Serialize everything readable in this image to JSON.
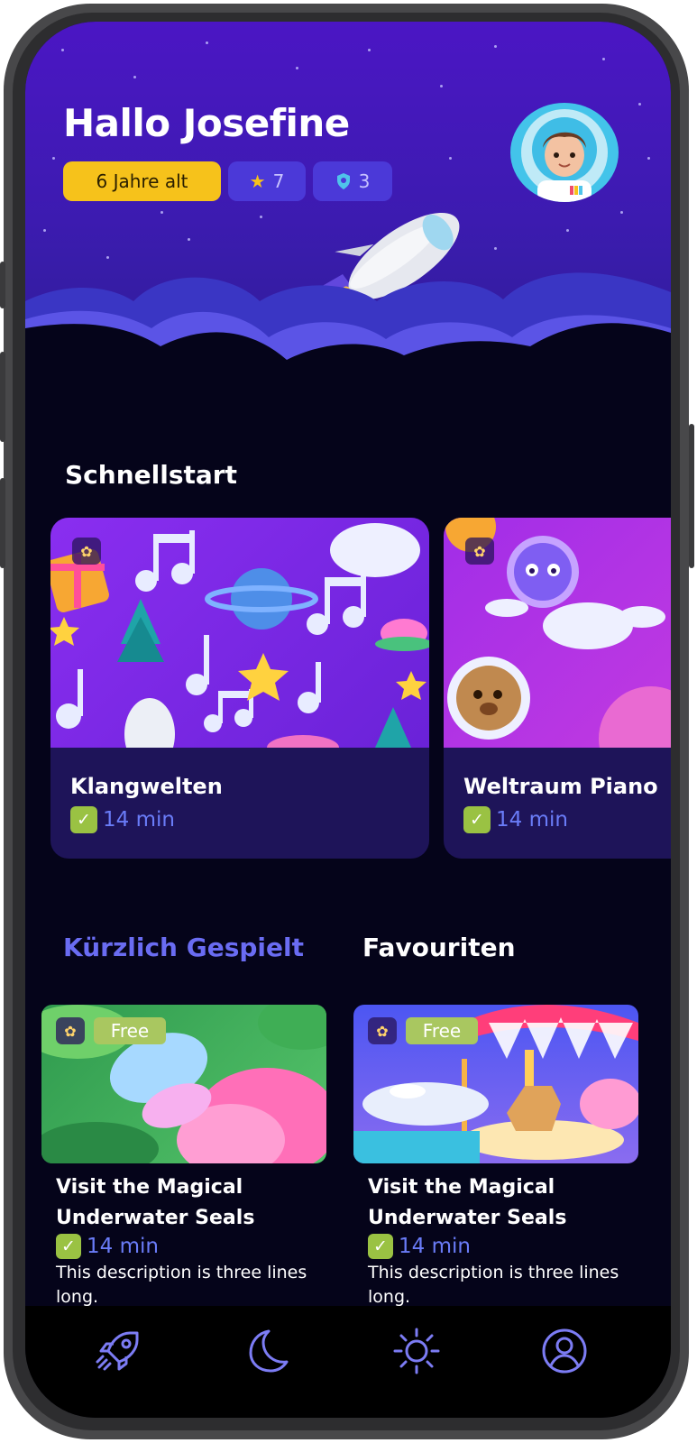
{
  "header": {
    "greeting": "Hallo Josefine",
    "age_chip": "6 Jahre alt",
    "stars_count": "7",
    "badges_count": "3"
  },
  "quickstart": {
    "title": "Schnellstart",
    "cards": [
      {
        "title": "Klangwelten",
        "duration": "14 min"
      },
      {
        "title": "Weltraum Piano",
        "duration": "14 min"
      }
    ]
  },
  "tabs": [
    {
      "label": "Kürzlich Gespielt",
      "active": true
    },
    {
      "label": "Favouriten",
      "active": false
    }
  ],
  "recent": [
    {
      "badge": "Free",
      "title": "Visit the Magical Underwater Seals",
      "duration": "14 min",
      "description": "This description is three lines long."
    },
    {
      "badge": "Free",
      "title": "Visit the Magical Underwater Seals",
      "duration": "14 min",
      "description": "This description is three lines long."
    }
  ],
  "nav": [
    "rocket-icon",
    "moon-icon",
    "sun-icon",
    "profile-icon"
  ],
  "colors": {
    "accent": "#6a6cf2",
    "header_purple": "#4b16c4",
    "background": "#05041a",
    "chip_yellow": "#f6c21b",
    "check_green": "#9ac243"
  }
}
